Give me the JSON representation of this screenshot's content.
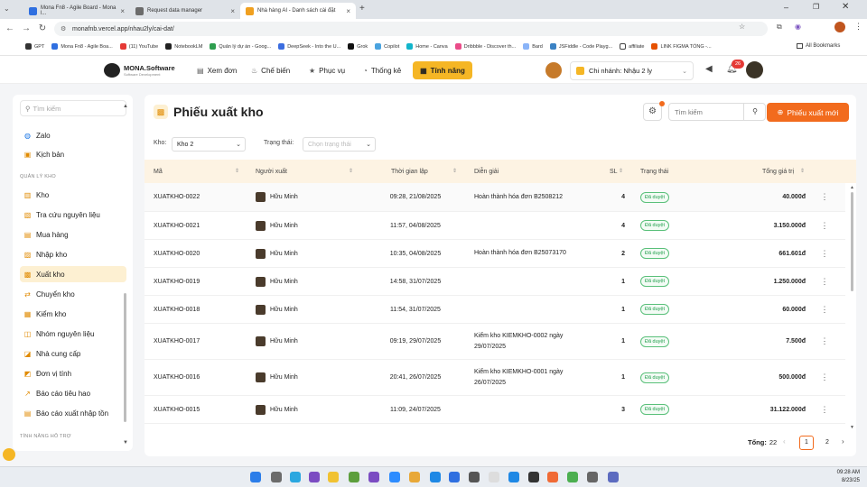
{
  "browser": {
    "tabs": [
      {
        "title": "Mona Fn8 - Agile Board - Mona l...",
        "color": "#2f6fe0"
      },
      {
        "title": "Request data manager",
        "color": "#6b6b6b"
      },
      {
        "title": "Nhà hàng AI - Danh sách cài đặt",
        "color": "#f0a020"
      }
    ],
    "url": "monafnb.vercel.app/nhau2ly/cai-dat/",
    "bookmarks": [
      "GPT",
      "Mona Fn8 - Agile Boa...",
      "(11) YouTube",
      "NotebookLM",
      "Quản lý dự án - Goog...",
      "DeepSeek - Into the U...",
      "Grok",
      "Copilot",
      "Home - Canva",
      "Dribbble - Discover th...",
      "Bard",
      "JSFiddle - Code Playg...",
      "affiliate",
      "LINK FIGMA TỔNG -..."
    ],
    "all_bookmarks": "All Bookmarks"
  },
  "header": {
    "logo_title": "MONA.Software",
    "logo_sub": "Software Development",
    "nav": [
      "Xem đơn",
      "Chế biến",
      "Phục vụ",
      "Thống kê",
      "Tính năng"
    ],
    "branch": "Chi nhánh: Nhậu 2 ly",
    "notif_count": "26"
  },
  "sidebar": {
    "search_placeholder": "Tìm kiếm",
    "top_items": [
      "Zalo",
      "Kịch bản"
    ],
    "section_label": "QUẢN LÝ KHO",
    "items": [
      "Kho",
      "Tra cứu nguyên liệu",
      "Mua hàng",
      "Nhập kho",
      "Xuất kho",
      "Chuyển kho",
      "Kiểm kho",
      "Nhóm nguyên liệu",
      "Nhà cung cấp",
      "Đơn vị tính",
      "Báo cáo tiêu hao",
      "Báo cáo xuất nhập tồn"
    ],
    "active_item": "Xuất kho",
    "footer_label": "TÍNH NĂNG HỖ TRỢ"
  },
  "main": {
    "title": "Phiếu xuất kho",
    "search_placeholder": "Tìm kiếm",
    "new_button": "Phiếu xuất mới",
    "filter_kho_label": "Kho:",
    "filter_kho_value": "Kho 2",
    "filter_status_label": "Trạng thái:",
    "filter_status_placeholder": "Chọn trạng thái",
    "columns": [
      "Mã",
      "Người xuất",
      "Thời gian lập",
      "Diễn giải",
      "SL",
      "Trạng thái",
      "Tổng giá trị"
    ],
    "rows": [
      {
        "ma": "XUATKHO-0022",
        "nguoi": "Hữu Minh",
        "time": "09:28, 21/08/2025",
        "dien_giai": "Hoàn thành hóa đơn B2508212",
        "sl": "4",
        "status": "Đã duyệt",
        "total": "40.000đ"
      },
      {
        "ma": "XUATKHO-0021",
        "nguoi": "Hữu Minh",
        "time": "11:57, 04/08/2025",
        "dien_giai": "",
        "sl": "4",
        "status": "Đã duyệt",
        "total": "3.150.000đ"
      },
      {
        "ma": "XUATKHO-0020",
        "nguoi": "Hữu Minh",
        "time": "10:35, 04/08/2025",
        "dien_giai": "Hoàn thành hóa đơn B25073170",
        "sl": "2",
        "status": "Đã duyệt",
        "total": "661.601đ"
      },
      {
        "ma": "XUATKHO-0019",
        "nguoi": "Hữu Minh",
        "time": "14:58, 31/07/2025",
        "dien_giai": "",
        "sl": "1",
        "status": "Đã duyệt",
        "total": "1.250.000đ"
      },
      {
        "ma": "XUATKHO-0018",
        "nguoi": "Hữu Minh",
        "time": "11:54, 31/07/2025",
        "dien_giai": "",
        "sl": "1",
        "status": "Đã duyệt",
        "total": "60.000đ"
      },
      {
        "ma": "XUATKHO-0017",
        "nguoi": "Hữu Minh",
        "time": "09:19, 29/07/2025",
        "dien_giai": "Kiểm kho KIEMKHO-0002 ngày 29/07/2025",
        "sl": "1",
        "status": "Đã duyệt",
        "total": "7.500đ"
      },
      {
        "ma": "XUATKHO-0016",
        "nguoi": "Hữu Minh",
        "time": "20:41, 26/07/2025",
        "dien_giai": "Kiểm kho KIEMKHO-0001 ngày 26/07/2025",
        "sl": "1",
        "status": "Đã duyệt",
        "total": "500.000đ"
      },
      {
        "ma": "XUATKHO-0015",
        "nguoi": "Hữu Minh",
        "time": "11:09, 24/07/2025",
        "dien_giai": "",
        "sl": "3",
        "status": "Đã duyệt",
        "total": "31.122.000đ"
      }
    ],
    "total_label": "Tổng:",
    "total_count": "22",
    "pages": [
      "1",
      "2"
    ]
  },
  "taskbar": {
    "time": "09:28 AM",
    "date": "8/23/25"
  },
  "colors": {
    "accent": "#f26b1d",
    "features": "#f5b625",
    "status_green": "#1e9e4a"
  }
}
